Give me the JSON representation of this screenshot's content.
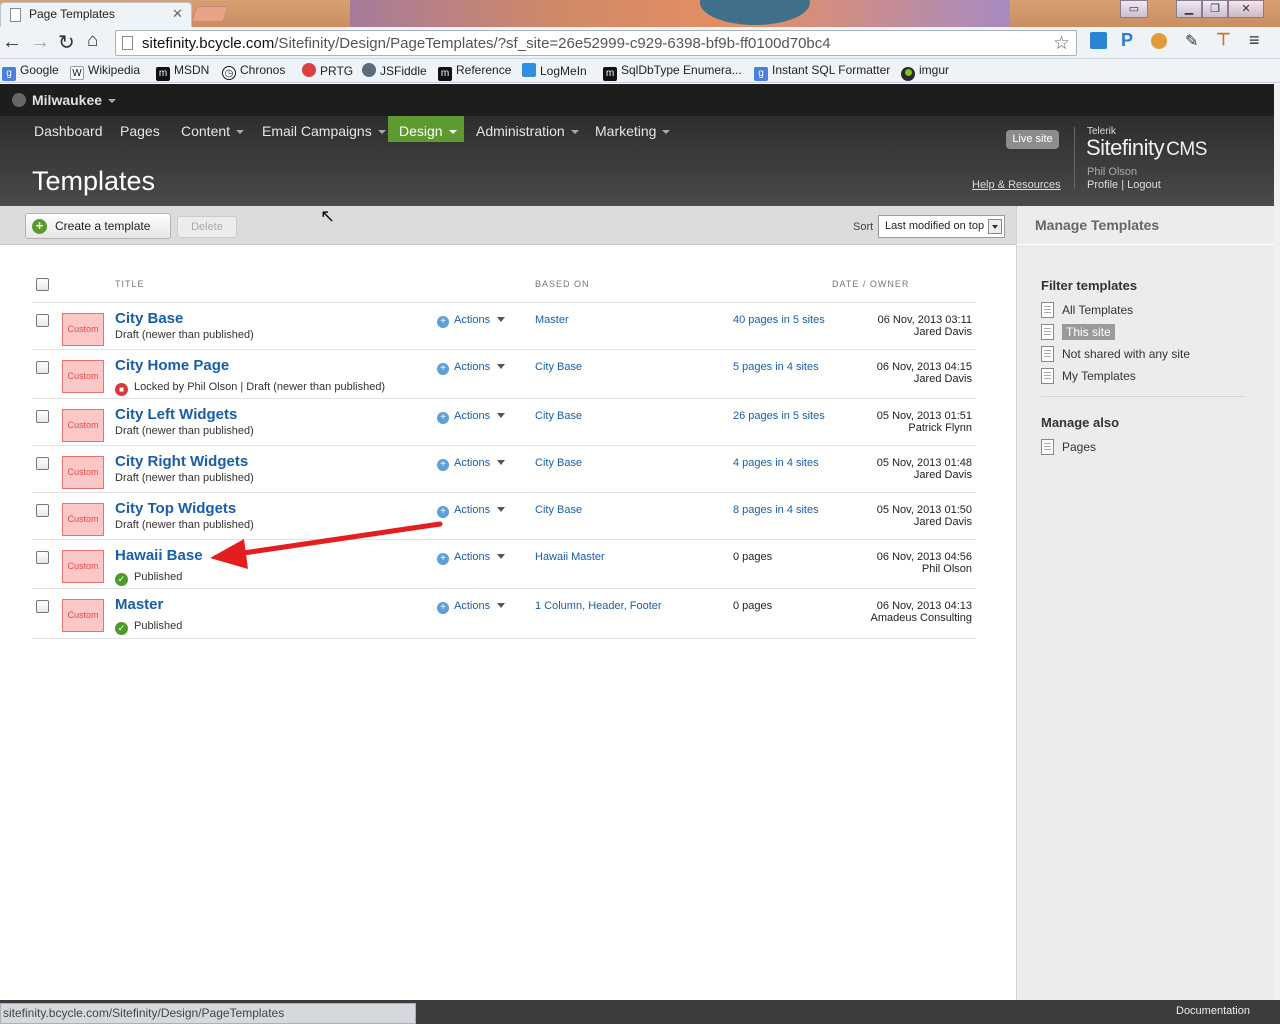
{
  "browser": {
    "tab_title": "Page Templates",
    "url_domain": "sitefinity.bcycle.com",
    "url_path": "/Sitefinity/Design/PageTemplates/?sf_site=26e52999-c929-6398-bf9b-ff0100d70bc4",
    "status_url": "sitefinity.bcycle.com/Sitefinity/Design/PageTemplates",
    "bookmarks": [
      "Google",
      "Wikipedia",
      "MSDN",
      "Chronos",
      "PRTG",
      "JSFiddle",
      "Reference",
      "LogMeIn",
      "SqlDbType Enumera...",
      "Instant SQL Formatter",
      "imgur"
    ]
  },
  "site": {
    "name": "Milwaukee",
    "nav": [
      "Dashboard",
      "Pages",
      "Content",
      "Email Campaigns",
      "Design",
      "Administration",
      "Marketing"
    ],
    "page_title": "Templates",
    "live_site": "Live site",
    "help": "Help & Resources",
    "brand_small": "Telerik",
    "brand": "Sitefinity",
    "brand_suffix": "CMS",
    "user": "Phil Olson",
    "profile": "Profile",
    "logout": "Logout"
  },
  "toolbar": {
    "create": "Create a template",
    "delete": "Delete",
    "sort_label": "Sort",
    "sort_value": "Last modified on top"
  },
  "columns": {
    "title": "TITLE",
    "based_on": "BASED ON",
    "date_owner": "DATE / OWNER"
  },
  "rows": [
    {
      "thumb": "Custom",
      "title": "City Base",
      "status": "Draft (newer than published)",
      "actions": "Actions",
      "based_on": "Master",
      "pages": "40 pages in 5 sites",
      "date": "06 Nov, 2013 03:11",
      "owner": "Jared Davis"
    },
    {
      "thumb": "Custom",
      "title": "City Home Page",
      "status": "Locked by Phil Olson | Draft (newer than published)",
      "actions": "Actions",
      "based_on": "City Base",
      "pages": "5 pages in 4 sites",
      "date": "06 Nov, 2013 04:15",
      "owner": "Jared Davis"
    },
    {
      "thumb": "Custom",
      "title": "City Left Widgets",
      "status": "Draft (newer than published)",
      "actions": "Actions",
      "based_on": "City Base",
      "pages": "26 pages in 5 sites",
      "date": "05 Nov, 2013 01:51",
      "owner": "Patrick Flynn"
    },
    {
      "thumb": "Custom",
      "title": "City Right Widgets",
      "status": "Draft (newer than published)",
      "actions": "Actions",
      "based_on": "City Base",
      "pages": "4 pages in 4 sites",
      "date": "05 Nov, 2013 01:48",
      "owner": "Jared Davis"
    },
    {
      "thumb": "Custom",
      "title": "City Top Widgets",
      "status": "Draft (newer than published)",
      "actions": "Actions",
      "based_on": "City Base",
      "pages": "8 pages in 4 sites",
      "date": "05 Nov, 2013 01:50",
      "owner": "Jared Davis"
    },
    {
      "thumb": "Custom",
      "title": "Hawaii Base",
      "status": "Published",
      "actions": "Actions",
      "based_on": "Hawaii Master",
      "pages": "0 pages",
      "date": "06 Nov, 2013 04:56",
      "owner": "Phil Olson"
    },
    {
      "thumb": "Custom",
      "title": "Master",
      "status": "Published",
      "actions": "Actions",
      "based_on": "1 Column, Header, Footer",
      "pages": "0 pages",
      "date": "06 Nov, 2013 04:13",
      "owner": "Amadeus Consulting"
    }
  ],
  "sidebar": {
    "heading": "Manage Templates",
    "filter_heading": "Filter templates",
    "filters": [
      "All Templates",
      "This site",
      "Not shared with any site",
      "My Templates"
    ],
    "selected_filter": "This site",
    "manage_also": "Manage also",
    "manage_links": [
      "Pages"
    ]
  },
  "footer": {
    "documentation": "Documentation"
  },
  "colors": {
    "accent_green": "#5e9a2f",
    "link_blue": "#1a5da8",
    "annotation_red": "#e41e1e"
  }
}
